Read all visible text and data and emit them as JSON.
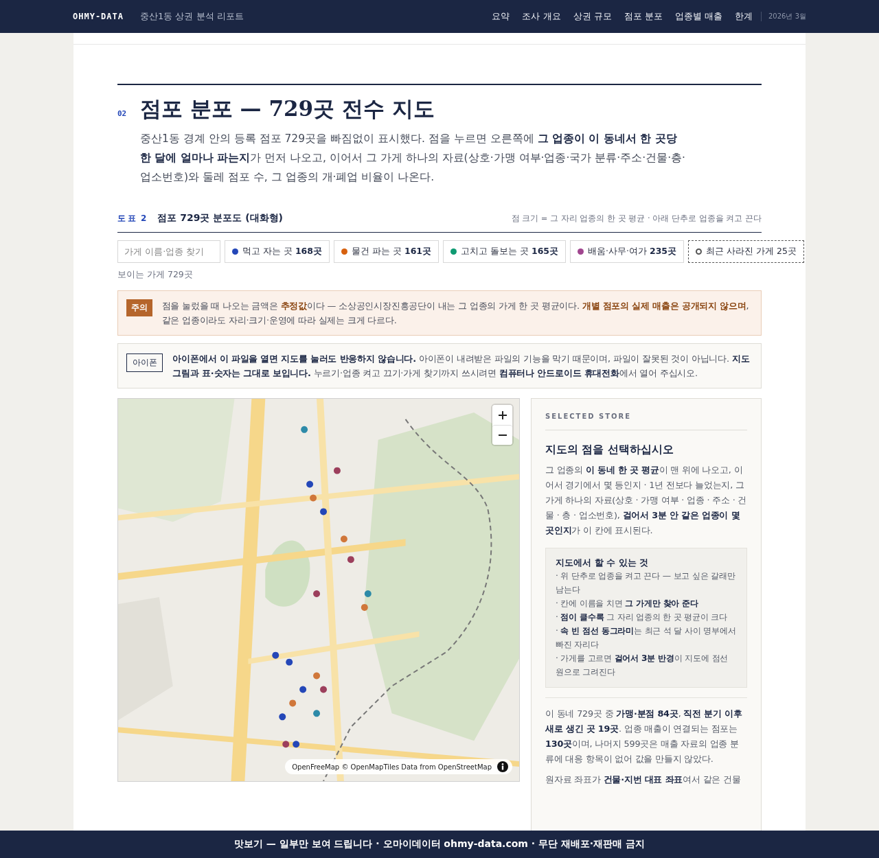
{
  "header": {
    "brand": "OHMY-DATA",
    "report_title": "중산1동 상권 분석 리포트",
    "nav": [
      {
        "label": "요약"
      },
      {
        "label": "조사 개요"
      },
      {
        "label": "상권 규모"
      },
      {
        "label": "점포 분포"
      },
      {
        "label": "업종별 매출"
      },
      {
        "label": "한계"
      }
    ],
    "date": "2026년 3월"
  },
  "section": {
    "number": "02",
    "title": "점포 분포 — 729곳 전수 지도",
    "intro": "중산1동 경계 안의 등록 점포 729곳을 빠짐없이 표시했다. 점을 누르면 오른쪽에 **그 업종이 이 동네서 한 곳당 한 달에 얼마나 파는지**가 먼저 나오고, 이어서 그 가게 하나의 자료(상호·가맹 여부·업종·국가 분류·주소·건물·층·업소번호)와 둘레 점포 수, 그 업종의 개·폐업 비율이 나온다."
  },
  "figure": {
    "label": "도표",
    "number": "2",
    "title": "점포 729곳 분포도 (대화형)",
    "note": "점 크기 = 그 자리 업종의 한 곳 평균 · 아래 단추로 업종을 켜고 끈다",
    "search": {
      "placeholder": "가게 이름·업종 찾기"
    },
    "filters": [
      {
        "kind": "dot",
        "label": "먹고 자는 곳 **168곳**",
        "color": "#2447b8"
      },
      {
        "kind": "dot",
        "label": "물건 파는 곳 **161곳**",
        "color": "#d7610f"
      },
      {
        "kind": "dot",
        "label": "고치고 돌보는 곳 **165곳**",
        "color": "#0f9a72"
      },
      {
        "kind": "dot",
        "label": "배움·사무·여가 **235곳**",
        "color": "#a0468f"
      },
      {
        "kind": "ring",
        "label": "최근 사라진 가게 25곳",
        "color": "#555555"
      }
    ],
    "visible_count": "보이는 가게 729곳"
  },
  "notices": [
    {
      "kind": "caution",
      "badge": "주의",
      "text": "점을 눌렀을 때 나오는 금액은 **추정값**이다 — 소상공인시장진흥공단이 내는 그 업종의 가게 한 곳 평균이다. **개별 점포의 실제 매출은 공개되지 않으며**, 같은 업종이라도 자리·크기·운영에 따라 실제는 크게 다르다."
    },
    {
      "kind": "device",
      "badge": "아이폰",
      "text": "**아이폰에서 이 파일을 열면 지도를 눌러도 반응하지 않습니다.** 아이폰이 내려받은 파일의 기능을 막기 때문이며, 파일이 잘못된 것이 아닙니다. **지도 그림과 표·숫자는 그대로 보입니다.** 누르기·업종 켜고 끄기·가게 찾기까지 쓰시려면 **컴퓨터나 안드로이드 휴대전화**에서 열어 주십시오."
    }
  ],
  "map": {
    "kind": "picture",
    "attribution": "OpenFreeMap © OpenMapTiles Data from OpenStreetMap"
  },
  "panel": {
    "eyebrow": "SELECTED STORE",
    "title": "지도의 점을 선택하십시오",
    "description": "그 업종의 **이 동네 한 곳 평균**이 맨 위에 나오고, 이어서 경기에서 몇 등인지 · 1년 전보다 늘었는지, 그 가게 하나의 자료(상호 · 가맹 여부 · 업종 · 주소 · 건물 · 층 · 업소번호), **걸어서 3분 안 같은 업종이 몇 곳인지**가 이 칸에 표시된다.",
    "help": {
      "title": "지도에서 할 수 있는 것",
      "items": [
        "· 위 단추로 업종을 켜고 끈다 — 보고 싶은 갈래만 남는다",
        "· 칸에 이름을 치면 **그 가게만 찾아 준다**",
        "· **점이 클수록** 그 자리 업종의 한 곳 평균이 크다",
        "· **속 빈 점선 동그라미**는 최근 석 달 사이 명부에서 빠진 자리다",
        "· 가게를 고르면 **걸어서 3분 반경**이 지도에 점선 원으로 그려진다"
      ]
    },
    "notes": [
      "이 동네 729곳 중 **가맹·분점 84곳**, **직전 분기 이후 새로 생긴 곳 19곳**. 업종 매출이 연결되는 점포는 **130곳**이며, 나머지 599곳은 매출 자료의 업종 분류에 대응 항목이 없어 값을 만들지 않았다.",
      "원자료 좌표가 **건물·지번 대표 좌표**여서 같은 건물"
    ]
  },
  "footer": "맛보기 — 일부만 보여 드립니다 · 오마이데이터 ohmy-data.com · 무단 재배포·재판매 금지"
}
